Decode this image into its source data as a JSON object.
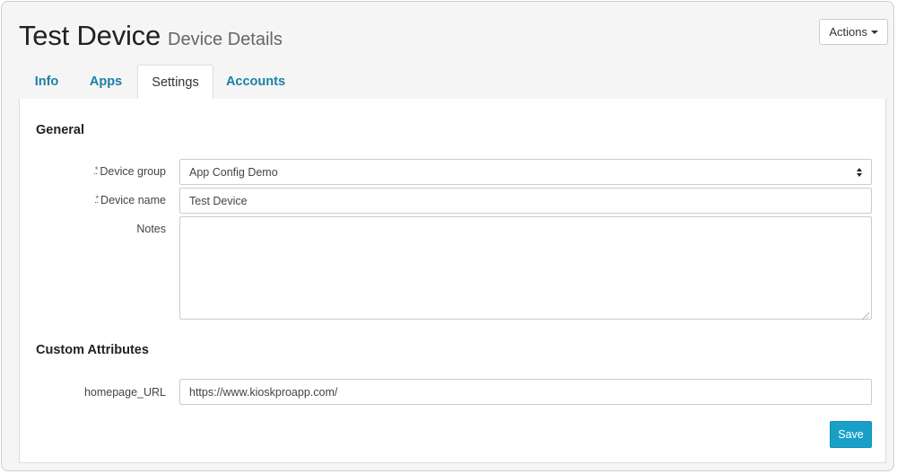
{
  "header": {
    "title": "Test Device",
    "subtitle": "Device Details",
    "actions_label": "Actions"
  },
  "tabs": [
    {
      "label": "Info",
      "active": false
    },
    {
      "label": "Apps",
      "active": false
    },
    {
      "label": "Settings",
      "active": true
    },
    {
      "label": "Accounts",
      "active": false
    }
  ],
  "general": {
    "heading": "General",
    "required_marker": "*",
    "device_group": {
      "label": "Device group",
      "value": "App Config Demo"
    },
    "device_name": {
      "label": "Device name",
      "value": "Test Device"
    },
    "notes": {
      "label": "Notes",
      "value": ""
    }
  },
  "custom_attributes": {
    "heading": "Custom Attributes",
    "homepage_url": {
      "label": "homepage_URL",
      "value": "https://www.kioskproapp.com/"
    }
  },
  "save_label": "Save",
  "colors": {
    "accent": "#19a0c8",
    "tab_link": "#1b7fa6",
    "background": "#f5f5f5"
  }
}
